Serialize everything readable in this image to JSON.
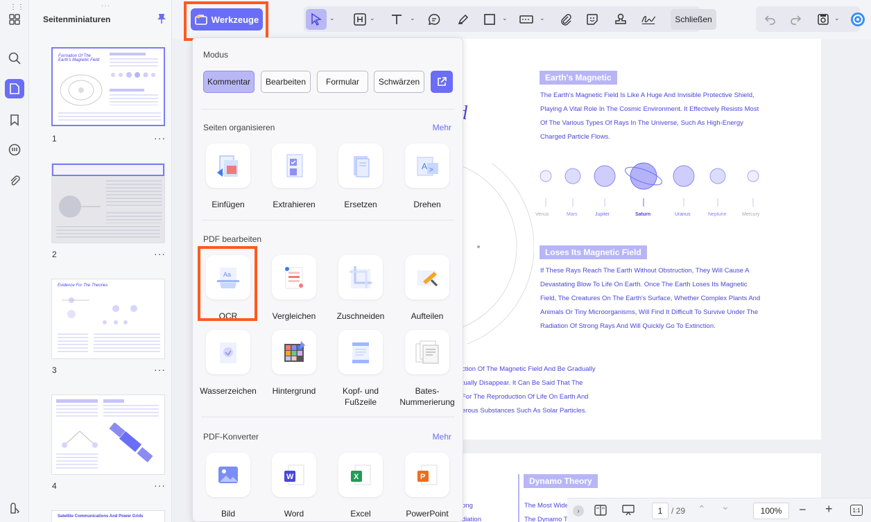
{
  "thumbs_panel": {
    "title": "Seitenminiaturen",
    "pages": [
      "1",
      "2",
      "3",
      "4"
    ],
    "more": "···"
  },
  "toolbar": {
    "werkzeuge_label": "Werkzeuge",
    "close_label": "Schließen"
  },
  "popup": {
    "mode_title": "Modus",
    "modes": [
      "Kommentar",
      "Bearbeiten",
      "Formular",
      "Schwärzen"
    ],
    "organize_title": "Seiten organisieren",
    "organize_more": "Mehr",
    "organize_tools": [
      "Einfügen",
      "Extrahieren",
      "Ersetzen",
      "Drehen"
    ],
    "edit_title": "PDF bearbeiten",
    "edit_tools_row1": [
      "OCR",
      "Vergleichen",
      "Zuschneiden",
      "Aufteilen"
    ],
    "edit_tools_row2": [
      "Wasserzeichen",
      "Hintergrund",
      "Kopf- und Fußzeile",
      "Bates-Nummerierung"
    ],
    "convert_title": "PDF-Konverter",
    "convert_more": "Mehr",
    "convert_tools": [
      "Bild",
      "Word",
      "Excel",
      "PowerPoint"
    ]
  },
  "document": {
    "tag1": "Earth's Magnetic",
    "para1": [
      "The Earth's Magnetic Field Is Like A Huge And Invisible Protective Shield,",
      "Playing A Vital Role In The Cosmic Environment. It Effectively Resists Most",
      "Of The Various Types Of Rays In The Universe, Such As High-Energy",
      "Charged Particle Flows."
    ],
    "planets": [
      "Venus",
      "Mars",
      "Jupiter",
      "Saturn",
      "Uranus",
      "Neptune",
      "Mercury"
    ],
    "tag2": "Loses Its Magnetic Field",
    "para2": [
      "If These Rays Reach The Earth Without Obstruction, They Will Cause A",
      "Devastating Blow To Life On Earth. Once The Earth Loses Its Magnetic",
      "Field, The Creatures On The Earth's Surface, Whether Complex Plants And",
      "Animals Or Tiny Microorganisms, Will Find It Difficult To Survive Under The",
      "Radiation Of Strong Rays And Will Quickly Go To Extinction."
    ],
    "para3": [
      "ction Of The Magnetic Field And Be Gradually",
      "tually Disappear. It Can Be Said That The",
      "For The Reproduction Of Life On Earth And",
      "erous Substances Such As Solar Particles."
    ],
    "title_fragment": "d",
    "tag3": "Dynamo Theory",
    "p2_lines": [
      "The Most Wide",
      "The Dynamo T"
    ],
    "p2_left": [
      "ong",
      "diation"
    ]
  },
  "statusbar": {
    "page_current": "1",
    "page_total": "/ 29",
    "zoom": "100%",
    "fit": "1:1"
  },
  "colors": {
    "accent": "#6a6df5",
    "highlight": "#ff5a1f",
    "doc_text": "#4a46d8"
  }
}
